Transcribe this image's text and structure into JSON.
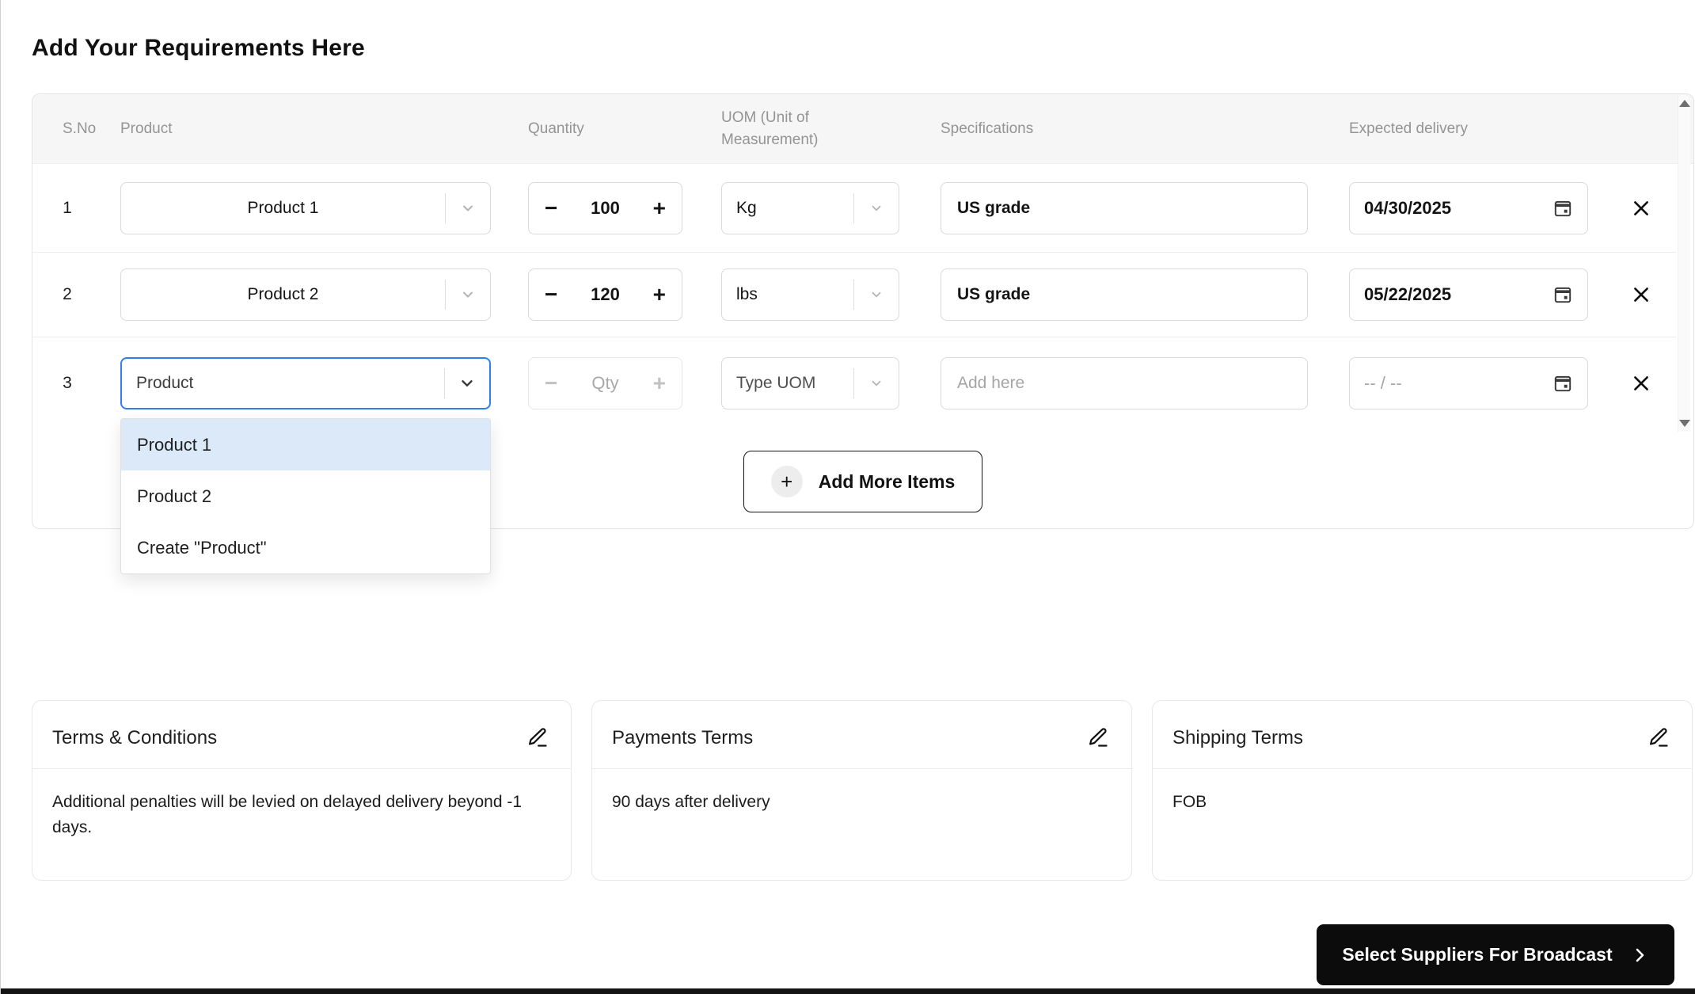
{
  "page": {
    "title": "Add Your Requirements Here",
    "colors": {
      "accent_blue": "#2f80ed",
      "dropdown_highlight": "#dbe9f9",
      "button_black": "#0c0c0c",
      "header_gray": "#f6f6f6"
    }
  },
  "table": {
    "headers": {
      "sno": "S.No",
      "product": "Product",
      "quantity": "Quantity",
      "uom": "UOM (Unit of Measurement)",
      "specifications": "Specifications",
      "expected_delivery": "Expected delivery"
    },
    "stepper": {
      "minus": "−",
      "plus": "+"
    },
    "rows": [
      {
        "sno": "1",
        "product": "Product 1",
        "quantity": "100",
        "uom": "Kg",
        "specifications": "US grade",
        "expected_delivery": "04/30/2025"
      },
      {
        "sno": "2",
        "product": "Product 2",
        "quantity": "120",
        "uom": "lbs",
        "specifications": "US grade",
        "expected_delivery": "05/22/2025"
      },
      {
        "sno": "3",
        "product_value": "Product",
        "quantity_placeholder": "Qty",
        "uom_placeholder": "Type UOM",
        "specifications_placeholder": "Add here",
        "expected_delivery_placeholder": "-- / --"
      }
    ],
    "add_more": {
      "label": "Add More Items",
      "plus": "+"
    }
  },
  "dropdown": {
    "items": [
      "Product 1",
      "Product 2",
      "Create \"Product\""
    ]
  },
  "cards": [
    {
      "title": "Terms & Conditions",
      "body": "Additional penalties will be levied on delayed delivery beyond -1 days."
    },
    {
      "title": "Payments Terms",
      "body": "90 days after delivery"
    },
    {
      "title": "Shipping Terms",
      "body": "FOB"
    }
  ],
  "footer": {
    "broadcast": "Select Suppliers For Broadcast"
  }
}
